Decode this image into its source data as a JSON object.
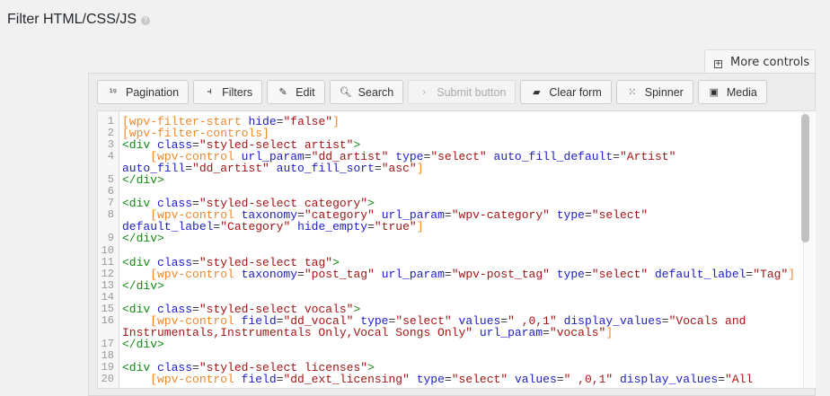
{
  "title": "Filter HTML/CSS/JS",
  "help_icon": "question-circle-icon",
  "more_controls": "More controls",
  "toolbar": [
    {
      "label": "Pagination",
      "icon": "pagination-icon",
      "glyph": "¹⁹",
      "disabled": false
    },
    {
      "label": "Filters",
      "icon": "filters-icon",
      "glyph": "⫞",
      "disabled": false
    },
    {
      "label": "Edit",
      "icon": "edit-icon",
      "glyph": "✎",
      "disabled": false
    },
    {
      "label": "Search",
      "icon": "search-icon",
      "glyph": "🔍︎",
      "disabled": false
    },
    {
      "label": "Submit button",
      "icon": "chevron-right-icon",
      "glyph": "›",
      "disabled": true
    },
    {
      "label": "Clear form",
      "icon": "eraser-icon",
      "glyph": "▰",
      "disabled": false
    },
    {
      "label": "Spinner",
      "icon": "spinner-icon",
      "glyph": "⁙",
      "disabled": false
    },
    {
      "label": "Media",
      "icon": "image-icon",
      "glyph": "▣",
      "disabled": false
    }
  ],
  "code": [
    {
      "n": "1",
      "t": [
        [
          "sc",
          "[wpv-filter-start "
        ],
        [
          "at",
          "hide"
        ],
        [
          "pl",
          "="
        ],
        [
          "st",
          "\"false\""
        ],
        [
          "sc",
          "]"
        ]
      ]
    },
    {
      "n": "2",
      "t": [
        [
          "sc",
          "[wpv-filter-controls]"
        ]
      ]
    },
    {
      "n": "3",
      "t": [
        [
          "tg",
          "<div "
        ],
        [
          "at",
          "class"
        ],
        [
          "pl",
          "="
        ],
        [
          "st",
          "\"styled-select artist\""
        ],
        [
          "tg",
          ">"
        ]
      ]
    },
    {
      "n": "4",
      "t": [
        [
          "sc",
          "    [wpv-control "
        ],
        [
          "at",
          "url_param"
        ],
        [
          "pl",
          "="
        ],
        [
          "st",
          "\"dd_artist\" "
        ],
        [
          "at",
          "type"
        ],
        [
          "pl",
          "="
        ],
        [
          "st",
          "\"select\" "
        ],
        [
          "at",
          "auto_fill_default"
        ],
        [
          "pl",
          "="
        ],
        [
          "st",
          "\"Artist\""
        ]
      ]
    },
    {
      "n": "",
      "t": [
        [
          "at",
          "auto_fill"
        ],
        [
          "pl",
          "="
        ],
        [
          "st",
          "\"dd_artist\" "
        ],
        [
          "at",
          "auto_fill_sort"
        ],
        [
          "pl",
          "="
        ],
        [
          "st",
          "\"asc\""
        ],
        [
          "sc",
          "]"
        ]
      ]
    },
    {
      "n": "5",
      "t": [
        [
          "tg",
          "</div>"
        ]
      ]
    },
    {
      "n": "6",
      "t": []
    },
    {
      "n": "7",
      "t": [
        [
          "tg",
          "<div "
        ],
        [
          "at",
          "class"
        ],
        [
          "pl",
          "="
        ],
        [
          "st",
          "\"styled-select category\""
        ],
        [
          "tg",
          ">"
        ]
      ]
    },
    {
      "n": "8",
      "t": [
        [
          "sc",
          "    [wpv-control "
        ],
        [
          "at",
          "taxonomy"
        ],
        [
          "pl",
          "="
        ],
        [
          "st",
          "\"category\" "
        ],
        [
          "at",
          "url_param"
        ],
        [
          "pl",
          "="
        ],
        [
          "st",
          "\"wpv-category\" "
        ],
        [
          "at",
          "type"
        ],
        [
          "pl",
          "="
        ],
        [
          "st",
          "\"select\""
        ]
      ]
    },
    {
      "n": "",
      "t": [
        [
          "at",
          "default_label"
        ],
        [
          "pl",
          "="
        ],
        [
          "st",
          "\"Category\" "
        ],
        [
          "at",
          "hide_empty"
        ],
        [
          "pl",
          "="
        ],
        [
          "st",
          "\"true\""
        ],
        [
          "sc",
          "]"
        ]
      ]
    },
    {
      "n": "9",
      "t": [
        [
          "tg",
          "</div>"
        ]
      ]
    },
    {
      "n": "10",
      "t": []
    },
    {
      "n": "11",
      "t": [
        [
          "tg",
          "<div "
        ],
        [
          "at",
          "class"
        ],
        [
          "pl",
          "="
        ],
        [
          "st",
          "\"styled-select tag\""
        ],
        [
          "tg",
          ">"
        ]
      ]
    },
    {
      "n": "12",
      "t": [
        [
          "sc",
          "    [wpv-control "
        ],
        [
          "at",
          "taxonomy"
        ],
        [
          "pl",
          "="
        ],
        [
          "st",
          "\"post_tag\" "
        ],
        [
          "at",
          "url_param"
        ],
        [
          "pl",
          "="
        ],
        [
          "st",
          "\"wpv-post_tag\" "
        ],
        [
          "at",
          "type"
        ],
        [
          "pl",
          "="
        ],
        [
          "st",
          "\"select\" "
        ],
        [
          "at",
          "default_label"
        ],
        [
          "pl",
          "="
        ],
        [
          "st",
          "\"Tag\""
        ],
        [
          "sc",
          "]"
        ]
      ]
    },
    {
      "n": "13",
      "t": [
        [
          "tg",
          "</div>"
        ]
      ]
    },
    {
      "n": "14",
      "t": []
    },
    {
      "n": "15",
      "t": [
        [
          "tg",
          "<div "
        ],
        [
          "at",
          "class"
        ],
        [
          "pl",
          "="
        ],
        [
          "st",
          "\"styled-select vocals\""
        ],
        [
          "tg",
          ">"
        ]
      ]
    },
    {
      "n": "16",
      "t": [
        [
          "sc",
          "    [wpv-control "
        ],
        [
          "at",
          "field"
        ],
        [
          "pl",
          "="
        ],
        [
          "st",
          "\"dd_vocal\" "
        ],
        [
          "at",
          "type"
        ],
        [
          "pl",
          "="
        ],
        [
          "st",
          "\"select\" "
        ],
        [
          "at",
          "values"
        ],
        [
          "pl",
          "="
        ],
        [
          "st",
          "\" ,0,1\" "
        ],
        [
          "at",
          "display_values"
        ],
        [
          "pl",
          "="
        ],
        [
          "st",
          "\"Vocals and"
        ]
      ]
    },
    {
      "n": "",
      "t": [
        [
          "st",
          "Instrumentals,Instrumentals Only,Vocal Songs Only\" "
        ],
        [
          "at",
          "url_param"
        ],
        [
          "pl",
          "="
        ],
        [
          "st",
          "\"vocals\""
        ],
        [
          "sc",
          "]"
        ]
      ]
    },
    {
      "n": "17",
      "t": [
        [
          "tg",
          "</div>"
        ]
      ]
    },
    {
      "n": "18",
      "t": []
    },
    {
      "n": "19",
      "t": [
        [
          "tg",
          "<div "
        ],
        [
          "at",
          "class"
        ],
        [
          "pl",
          "="
        ],
        [
          "st",
          "\"styled-select licenses\""
        ],
        [
          "tg",
          ">"
        ]
      ]
    },
    {
      "n": "20",
      "t": [
        [
          "sc",
          "    [wpv-control "
        ],
        [
          "at",
          "field"
        ],
        [
          "pl",
          "="
        ],
        [
          "st",
          "\"dd_ext_licensing\" "
        ],
        [
          "at",
          "type"
        ],
        [
          "pl",
          "="
        ],
        [
          "st",
          "\"select\" "
        ],
        [
          "at",
          "values"
        ],
        [
          "pl",
          "="
        ],
        [
          "st",
          "\" ,0,1\" "
        ],
        [
          "at",
          "display_values"
        ],
        [
          "pl",
          "="
        ],
        [
          "st",
          "\"All"
        ]
      ]
    }
  ]
}
